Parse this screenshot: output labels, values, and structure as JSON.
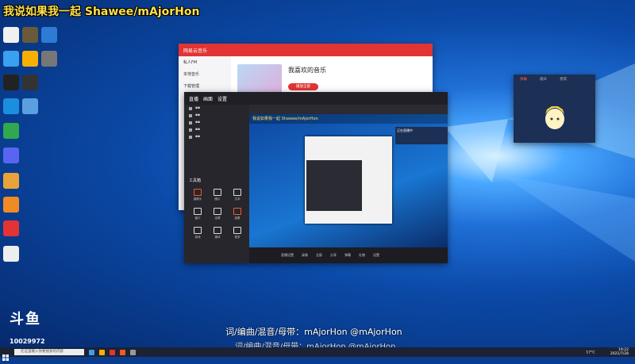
{
  "overlay": {
    "title": "我说如果我一起 Shawee/mAjorHon"
  },
  "music_window": {
    "app_name": "网易云音乐",
    "playlist_title": "我喜欢的音乐",
    "play_all_label": "播放全部",
    "sidebar_items": [
      "私人FM",
      "本地音乐",
      "下载管理"
    ]
  },
  "douyu_window": {
    "preview_caption": "我说如果我一起 Shawee/mAjorHon",
    "sidebar_title": "工具箱",
    "stream_tabs": [
      "直播",
      "画面",
      "设置"
    ],
    "tools": [
      "摄像头",
      "图片",
      "文本",
      "窗口",
      "全屏",
      "投屏",
      "游戏",
      "媒体",
      "更多"
    ],
    "notice": "正在直播中",
    "bottom_actions": [
      "直播设置",
      "录像",
      "全屏",
      "分享",
      "弹幕",
      "礼物",
      "设置"
    ]
  },
  "chat_panel": {
    "tabs": [
      "弹幕",
      "观众",
      "贵宾"
    ]
  },
  "douyu_brand": {
    "logo": "斗鱼",
    "room_id": "10029972"
  },
  "subtitles": {
    "line1": "词/编曲/混音/母带：mAjorHon @mAjorHon",
    "line2": "词/编曲/混音/母带：mAjorHon @mAjorHon"
  },
  "taskbar": {
    "search_placeholder": "在这里输入你要搜索的内容",
    "time": "19:22",
    "date": "2021/7/28",
    "weather": "17°C"
  },
  "colors": {
    "netease_red": "#e23434",
    "desktop_blue": "#1f6fd6",
    "douyu_dark": "#2b2b33",
    "overlay_yellow": "#ffe14a"
  }
}
